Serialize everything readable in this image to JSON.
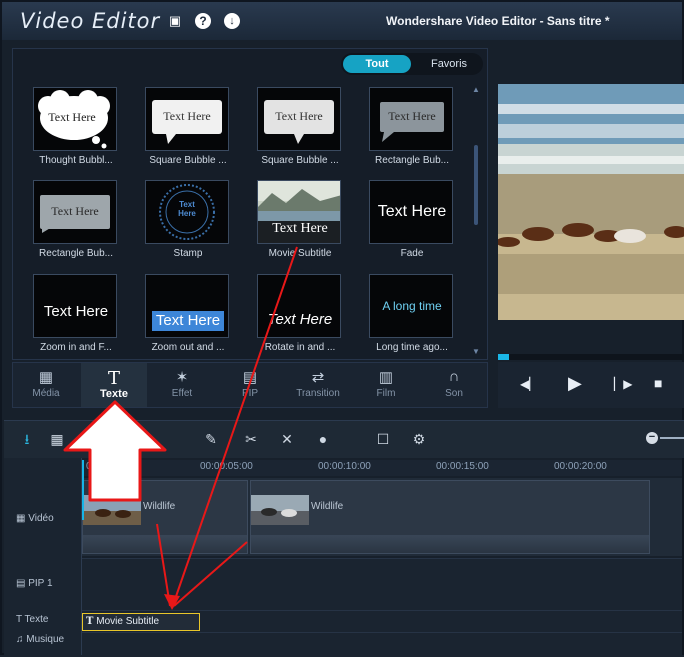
{
  "titlebar": {
    "logo": "Video Editor",
    "window_title": "Wondershare Video Editor - Sans titre *",
    "save_icon": "▣",
    "help_icon": "?",
    "download_icon": "↓"
  },
  "library": {
    "filters": {
      "all": "Tout",
      "favorites": "Favoris"
    },
    "scroll_up": "▲",
    "scroll_down": "▼",
    "items": [
      {
        "caption": "Thought Bubbl...",
        "text": "Text Here"
      },
      {
        "caption": "Square Bubble ...",
        "text": "Text Here"
      },
      {
        "caption": "Square Bubble ...",
        "text": "Text Here"
      },
      {
        "caption": "Rectangle Bub...",
        "text": "Text Here"
      },
      {
        "caption": "Rectangle Bub...",
        "text": "Text Here"
      },
      {
        "caption": "Stamp",
        "text": "Text Here"
      },
      {
        "caption": "Movie Subtitle",
        "text": "Text Here"
      },
      {
        "caption": "Fade",
        "text": "Text Here"
      },
      {
        "caption": "Zoom in and F...",
        "text": "Text Here"
      },
      {
        "caption": "Zoom out and ...",
        "text": "Text Here"
      },
      {
        "caption": "Rotate in and ...",
        "text": "Text Here"
      },
      {
        "caption": "Long time ago...",
        "text": "A long time"
      }
    ]
  },
  "categories": [
    {
      "label": "Média",
      "icon": "▦"
    },
    {
      "label": "Texte",
      "icon": "T"
    },
    {
      "label": "Effet",
      "icon": "✶"
    },
    {
      "label": "PIP",
      "icon": "▤"
    },
    {
      "label": "Transition",
      "icon": "⇄"
    },
    {
      "label": "Film",
      "icon": "▥"
    },
    {
      "label": "Son",
      "icon": "∩"
    }
  ],
  "transport": {
    "prev": "◀▏",
    "play": "▶",
    "next": "▏▶",
    "stop": "■"
  },
  "playback_progress": 0.06,
  "toolbar": {
    "tools": [
      "⭳",
      "▦",
      "✎",
      "✂",
      "✕",
      "●",
      "☐",
      "⚙"
    ],
    "zoom_out": "−"
  },
  "timeline": {
    "ticks": [
      "00:00:00:00",
      "00:00:05:00",
      "00:00:10:00",
      "00:00:15:00",
      "00:00:20:00"
    ],
    "tracks": {
      "video": "Vidéo",
      "pip": "PIP 1",
      "text": "Texte",
      "music": "Musique"
    },
    "track_icons": {
      "video": "▦",
      "pip": "▤",
      "text": "T",
      "music": "♫"
    },
    "clips": [
      {
        "label": "Wildlife"
      },
      {
        "label": "Wildlife"
      }
    ],
    "text_clip": {
      "icon": "T",
      "label": "Movie Subtitle"
    }
  },
  "colors": {
    "accent": "#16a3c4",
    "highlight_border": "#e8c62a",
    "arrow": "#e81818"
  }
}
